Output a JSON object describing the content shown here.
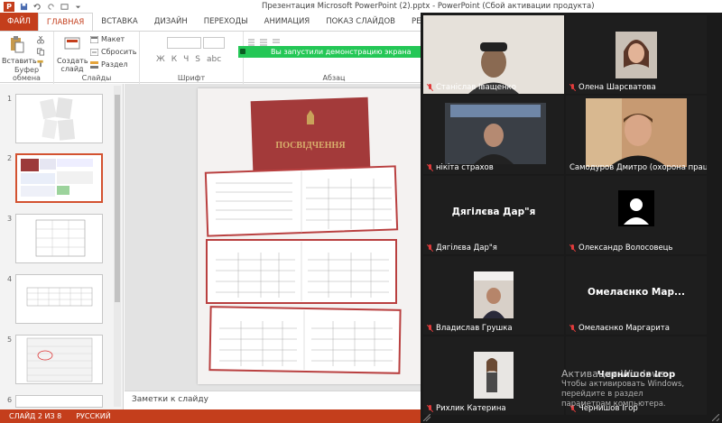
{
  "window": {
    "title": "Презентация Microsoft PowerPoint (2).pptx - PowerPoint (Сбой активации продукта)",
    "app_icon": "P"
  },
  "ribbon_tabs": [
    {
      "label": "ФАЙЛ"
    },
    {
      "label": "ГЛАВНАЯ"
    },
    {
      "label": "ВСТАВКА"
    },
    {
      "label": "ДИЗАЙН"
    },
    {
      "label": "ПЕРЕХОДЫ"
    },
    {
      "label": "АНИМАЦИЯ"
    },
    {
      "label": "ПОКАЗ СЛАЙДОВ"
    },
    {
      "label": "РЕЦЕНЗИРОВА"
    }
  ],
  "ribbon": {
    "paste_label": "Вставить",
    "clipboard_label": "Буфер обмена",
    "new_slide_label": "Создать слайд",
    "layout_label": "Макет",
    "reset_label": "Сбросить",
    "section_label": "Раздел",
    "slides_label": "Слайды",
    "font_label": "Шрифт",
    "paragraph_label": "Абзац",
    "font_buttons": [
      "Ж",
      "К",
      "Ч",
      "S",
      "abc"
    ]
  },
  "notification": {
    "text": "Вы запустили демонстрацию экрана"
  },
  "slides": [
    {
      "number": "1"
    },
    {
      "number": "2"
    },
    {
      "number": "3"
    },
    {
      "number": "4"
    },
    {
      "number": "5"
    },
    {
      "number": "6"
    }
  ],
  "document": {
    "cover_title": "ПОСВІДЧЕННЯ"
  },
  "notes_placeholder": "Заметки к слайду",
  "status": {
    "slide_info": "СЛАЙД 2 ИЗ 8",
    "language": "РУССКИЙ"
  },
  "participants": [
    {
      "name": "Станіслав Іващенко",
      "muted": true
    },
    {
      "name": "Олена Шарсватова",
      "muted": true
    },
    {
      "name": "нікіта страхов",
      "muted": true
    },
    {
      "name": "Самодуров Дмитро (охорона праці)",
      "muted": false
    },
    {
      "name": "Дягілєва Дар\"я",
      "display": "Дягілєва Дар\"я",
      "muted": true
    },
    {
      "name": "Олександр Волосовець",
      "muted": true
    },
    {
      "name": "Владислав Грушка",
      "muted": true
    },
    {
      "name": "Омелаєнко Маргарита",
      "display": "Омелаєнко Мар...",
      "muted": true
    },
    {
      "name": "Рихлик Катерина",
      "muted": true
    },
    {
      "name": "Чернишов Ігор",
      "display": "Чернишов Ігор",
      "muted": true
    }
  ],
  "watermark": {
    "line1": "Активация Windows",
    "line2": "Чтобы активировать Windows, перейдите в раздел",
    "line3": "параметрам компьютера."
  },
  "colors": {
    "accent": "#c43e1c",
    "notify": "#24c756",
    "speaking": "#e4d33a",
    "gallery_bg": "#1a1a1a"
  }
}
